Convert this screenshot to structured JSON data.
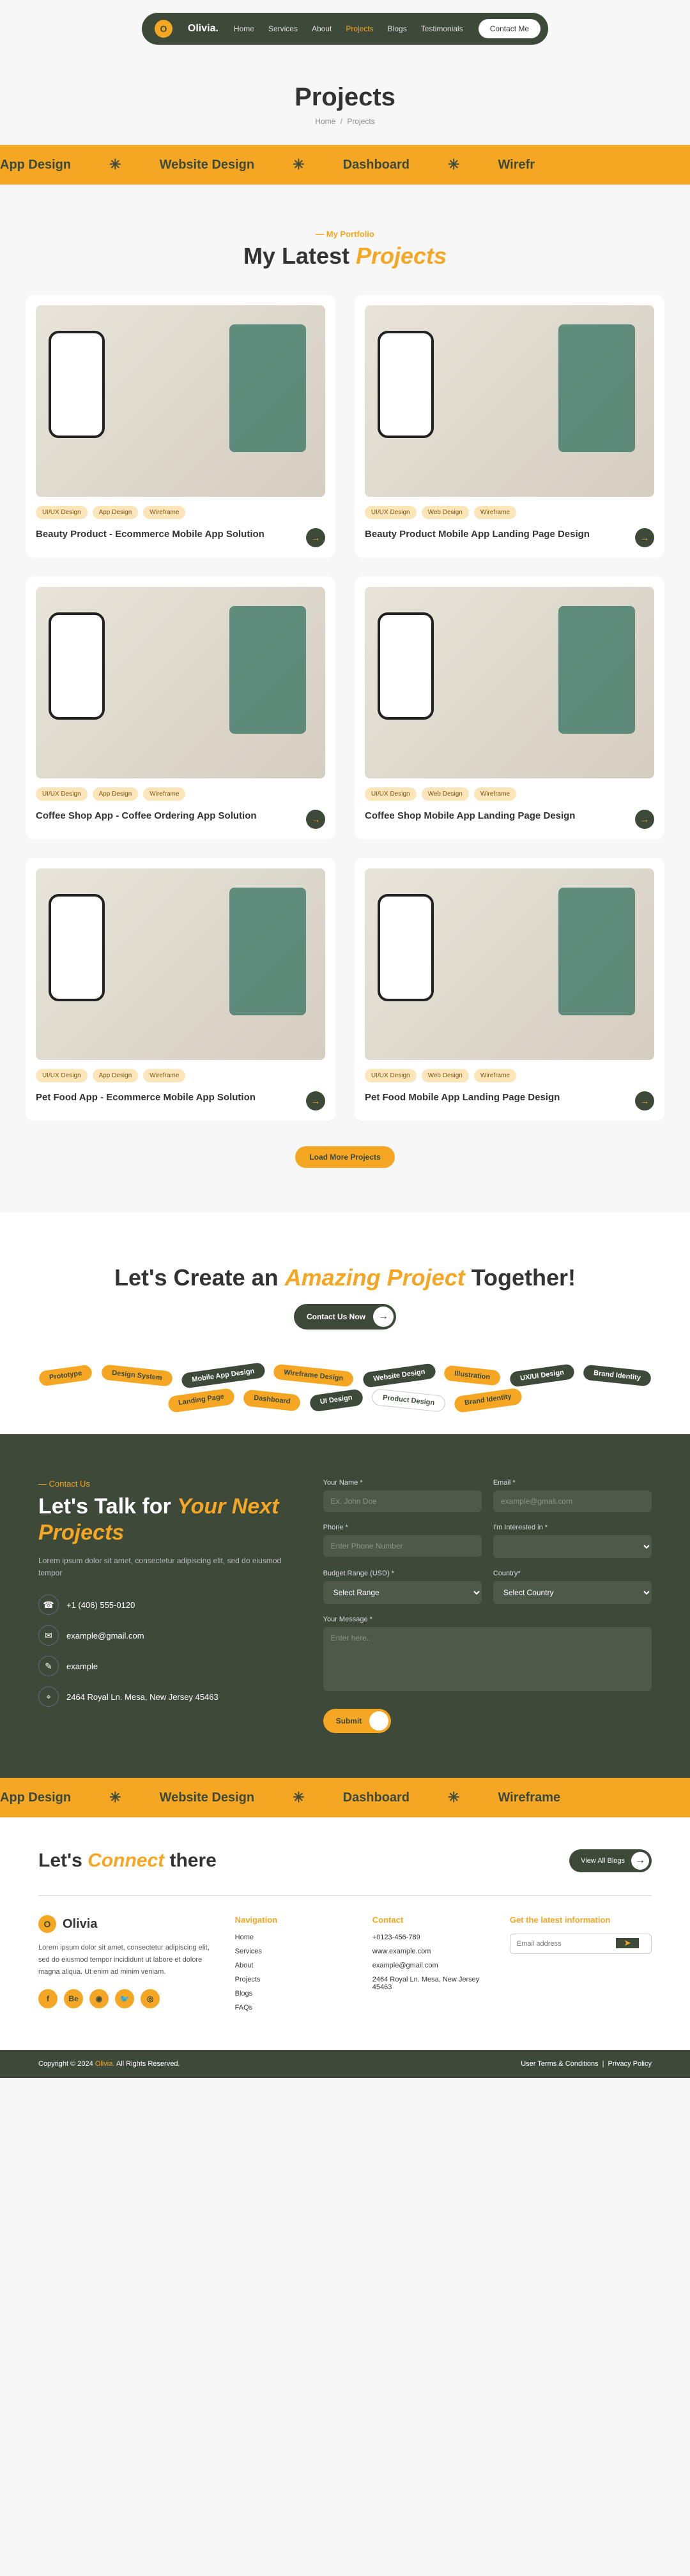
{
  "nav": {
    "brand": "Olivia.",
    "logo_letter": "O",
    "items": [
      "Home",
      "Services",
      "About",
      "Projects",
      "Blogs",
      "Testimonials"
    ],
    "active": "Projects",
    "contact_btn": "Contact Me"
  },
  "page": {
    "title": "Projects",
    "crumb_home": "Home",
    "crumb_current": "Projects"
  },
  "strip": [
    "App Design",
    "Website Design",
    "Dashboard",
    "Wirefr"
  ],
  "strip2": [
    "App Design",
    "Website Design",
    "Dashboard",
    "Wireframe"
  ],
  "portfolio": {
    "tag": "My Portfolio",
    "title_pre": "My Latest ",
    "title_accent": "Projects",
    "load_more": "Load More Projects",
    "items": [
      {
        "tags": [
          "UI/UX Design",
          "App Design",
          "Wireframe"
        ],
        "title": "Beauty Product - Ecommerce Mobile App Solution"
      },
      {
        "tags": [
          "UI/UX Design",
          "Web Design",
          "Wireframe"
        ],
        "title": "Beauty Product  Mobile App Landing Page Design"
      },
      {
        "tags": [
          "UI/UX Design",
          "App Design",
          "Wireframe"
        ],
        "title": "Coffee Shop App - Coffee Ordering App Solution"
      },
      {
        "tags": [
          "UI/UX Design",
          "Web Design",
          "Wireframe"
        ],
        "title": "Coffee Shop  Mobile App Landing Page Design"
      },
      {
        "tags": [
          "UI/UX Design",
          "App Design",
          "Wireframe"
        ],
        "title": "Pet Food App - Ecommerce Mobile App Solution"
      },
      {
        "tags": [
          "UI/UX Design",
          "Web Design",
          "Wireframe"
        ],
        "title": "Pet Food  Mobile App Landing Page Design"
      }
    ]
  },
  "cta": {
    "title_pre": "Let's Create an ",
    "title_accent": "Amazing Project",
    "title_post": " Together!",
    "btn": "Contact Us Now",
    "chips": [
      {
        "t": "Prototype",
        "c": "y"
      },
      {
        "t": "Design System",
        "c": "y"
      },
      {
        "t": "Mobile App Design",
        "c": "g"
      },
      {
        "t": "Wireframe Design",
        "c": "y"
      },
      {
        "t": "Website Design",
        "c": "g"
      },
      {
        "t": "Illustration",
        "c": "y"
      },
      {
        "t": "UX/UI Design",
        "c": "g"
      },
      {
        "t": "Brand Identity",
        "c": "g"
      },
      {
        "t": "Landing Page",
        "c": "y"
      },
      {
        "t": "Dashboard",
        "c": "y"
      },
      {
        "t": "UI Design",
        "c": "g"
      },
      {
        "t": "Product Design",
        "c": "w"
      },
      {
        "t": "Brand Identity",
        "c": "y"
      }
    ]
  },
  "contact": {
    "tag": "— Contact Us",
    "heading_pre": "Let's Talk for ",
    "heading_accent": "Your Next Projects",
    "blurb": "Lorem ipsum dolor sit amet, consectetur adipiscing elit, sed do eiusmod tempor",
    "info": [
      {
        "icon": "☎",
        "text": "+1 (406) 555-0120"
      },
      {
        "icon": "✉",
        "text": "example@gmail.com"
      },
      {
        "icon": "✎",
        "text": "example"
      },
      {
        "icon": "⌖",
        "text": "2464 Royal Ln. Mesa, New Jersey 45463"
      }
    ],
    "labels": {
      "name": "Your Name *",
      "email": "Email *",
      "phone": "Phone *",
      "interest": "I'm Interested in *",
      "budget": "Budget Range (USD) *",
      "country": "Country*",
      "message": "Your Message *"
    },
    "ph": {
      "name": "Ex. John Doe",
      "email": "example@gmail.com",
      "phone": "Enter Phone Number",
      "budget": "Select Range",
      "country": "Select Country",
      "message": "Enter here.."
    },
    "submit": "Submit"
  },
  "connect": {
    "title_pre": "Let's ",
    "title_accent": "Connect",
    "title_post": " there",
    "view_btn": "View All Blogs"
  },
  "footer": {
    "brand": "Olivia",
    "desc": "Lorem ipsum dolor sit amet, consectetur adipiscing elit, sed do eiusmod tempor incididunt ut labore et dolore magna aliqua. Ut enim ad minim veniam.",
    "socials": [
      "f",
      "Be",
      "◉",
      "🐦",
      "◎"
    ],
    "nav_head": "Navigation",
    "nav_links": [
      "Home",
      "Services",
      "About",
      "Projects",
      "Blogs",
      "FAQs"
    ],
    "contact_head": "Contact",
    "contact_lines": [
      "+0123-456-789",
      "www.example.com",
      "example@gmail.com",
      "2464 Royal Ln. Mesa, New Jersey 45463"
    ],
    "news_head": "Get the latest information",
    "news_ph": "Email address"
  },
  "bottom": {
    "copy_pre": "Copyright © 2024 ",
    "copy_brand": "Olivia.",
    "copy_post": " All Rights Reserved.",
    "terms": "User Terms & Conditions",
    "privacy": "Privacy Policy"
  }
}
